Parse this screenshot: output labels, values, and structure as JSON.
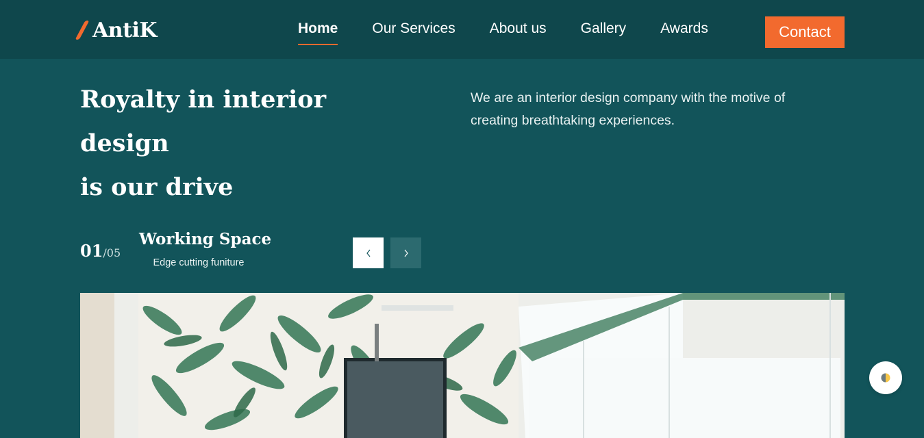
{
  "brand": {
    "name": "AntiK",
    "accent_color": "#f26a2e"
  },
  "nav": {
    "items": [
      {
        "label": "Home",
        "active": true
      },
      {
        "label": "Our Services",
        "active": false
      },
      {
        "label": "About us",
        "active": false
      },
      {
        "label": "Gallery",
        "active": false
      },
      {
        "label": "Awards",
        "active": false
      }
    ],
    "contact_label": "Contact"
  },
  "hero": {
    "title_line1": "Royalty in interior design",
    "title_line2": "is our drive",
    "description_line1": "We are an interior design company with the motive of",
    "description_line2": "creating breathtaking experiences."
  },
  "slider": {
    "current": "01",
    "separator": "/",
    "total": "05",
    "title": "Working Space",
    "subtitle": "Edge cutting funiture",
    "prev_icon": "chevron-left-icon",
    "next_icon": "chevron-right-icon"
  },
  "colors": {
    "background": "#12545a",
    "header": "#0f474c"
  },
  "widgets": {
    "theme_toggle_icon": "half-circle-theme-icon"
  }
}
